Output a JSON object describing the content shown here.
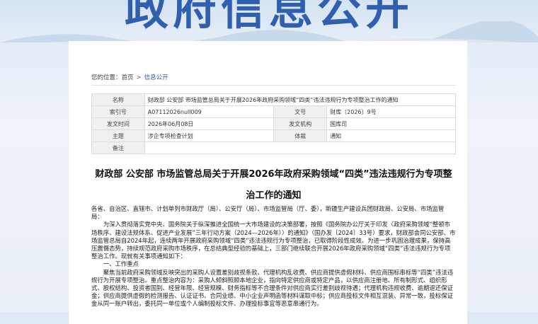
{
  "banner": {
    "title": "政府信息公开"
  },
  "breadcrumb": {
    "prefix": "您的位置：",
    "home": "首页",
    "separator": ">",
    "current": "信息公开"
  },
  "meta": {
    "rows": [
      {
        "k1": "名称",
        "v1": "财政部 公安部 市场监管总局关于开展2026年政府采购领域“四类”违法违规行为专项整治工作的通知",
        "full": true
      },
      {
        "k1": "索引号",
        "v1": "A07112026null009",
        "k2": "文号",
        "v2": "财库〔2026〕9号"
      },
      {
        "k1": "发文时间",
        "v1": "2026年06月08日",
        "k2": "发文机构",
        "v2": "国库司"
      },
      {
        "k1": "主题",
        "v1": "涉企专项检查计划",
        "k2": "体裁",
        "v2": "通知"
      },
      {
        "k1": "备注",
        "v1": "",
        "full": true
      }
    ]
  },
  "doc": {
    "title": "财政部 公安部 市场监管总局关于开展2026年政府采购领域“四类”违法违规行为专项整治工作的通知",
    "addressee": "各省、自治区、直辖市、计划单列市财政厅（局）、公安厅（局）、市场监管局（厅、委），新疆生产建设兵团财政局、公安局、市场监管局：",
    "para1": "为深入贯彻落实党中央、国务院关于纵深推进全国统一大市场建设的决策部署，按照《国务院办公厅关于印发〈政府采购领域“整顿市场秩序、建设法规体系、促进产业发展”三年行动方案（2024—2026年）〉的通知》（国办发〔2024〕33号）要求，财政部会同公安部、市场监管总局自2024年起，连续两年开展政府采购领域“四类”违法违规行为专项整治，已取得阶段性成效。为进一步巩固治理成果，保持高压震慑态势，持续规范政府采购市场秩序，在总结典型经验的基础上，三部门继续联合开展2026年政府采购领域“四类”违法违规行为专项整治工作。现就有关事项通知如下：",
    "heading1": "一、工作重点",
    "para2": "聚焦当前政府采购领域反映突出的采购人设置差别歧视条款、代理机构乱收费、供应商提供虚假材料、供应商围标串标等“四类”违法违规行为开展专项整治。重点整治内容为：采购人倾斜照顾本地企业，指向特定供应商或特定产品，以供应商注册地、所有制形式、组织形式、股权结构、投资者国别、经营年限、经营规模、财务指标等不合理条件对供应商实行差别歧视待遇；代理机构违规收费、逾期退还保证金；供应商提供虚假的检测报告、认证证书、合同业绩、中小企业声明函等材料谋取中标；供应商投标文件相互混装、异常一致，投标保证金从同一账户转出，委托同一单位或个人编制投标文件、办理投标事宜等恶意串通行为。"
  }
}
